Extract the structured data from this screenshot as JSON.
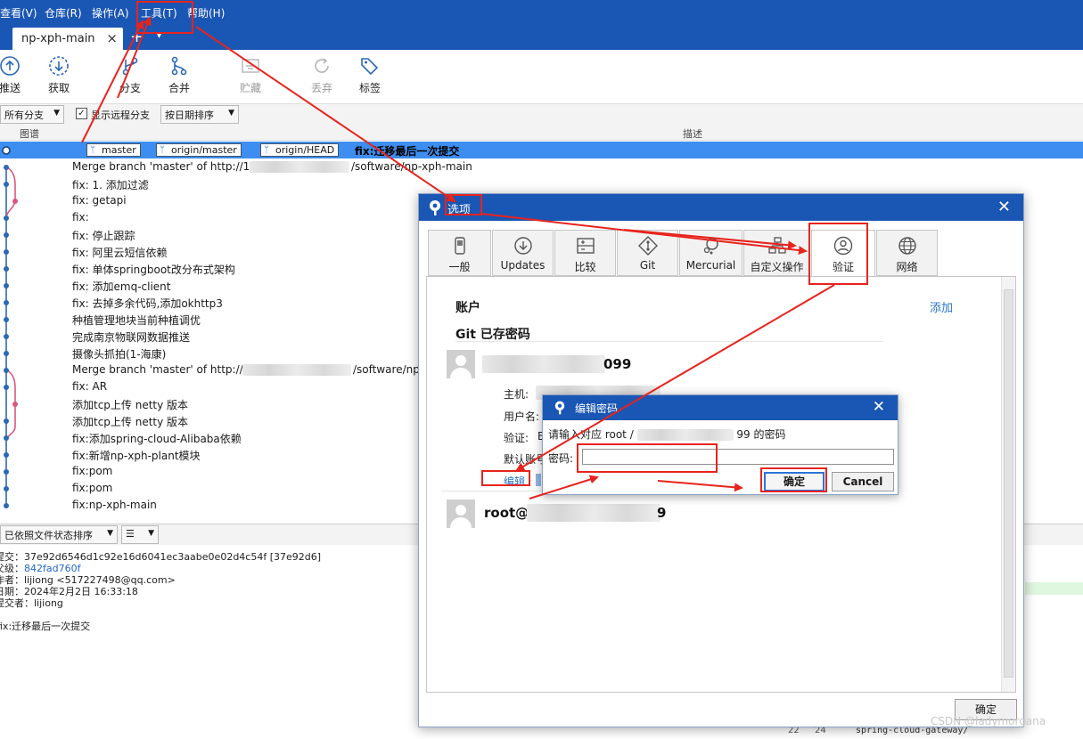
{
  "menu": {
    "items": [
      "查看(V)",
      "仓库(R)",
      "操作(A)",
      "工具(T)",
      "帮助(H)"
    ]
  },
  "tabbar": {
    "repo_tab_label": "np-xph-main",
    "close_glyph": "×",
    "add_glyph": "+",
    "dropdown_glyph": "▾"
  },
  "toolbar": {
    "buttons": [
      {
        "label": "推送",
        "icon": "push-icon",
        "enabled": true
      },
      {
        "label": "获取",
        "icon": "fetch-icon",
        "enabled": true
      },
      {
        "label": "分支",
        "icon": "branch-icon",
        "enabled": true
      },
      {
        "label": "合并",
        "icon": "merge-icon",
        "enabled": true
      },
      {
        "label": "贮藏",
        "icon": "stash-icon",
        "enabled": false
      },
      {
        "label": "丢弃",
        "icon": "discard-icon",
        "enabled": false
      },
      {
        "label": "标签",
        "icon": "tag-icon",
        "enabled": true
      }
    ]
  },
  "filter": {
    "branch_select": "所有分支",
    "show_remote_label": "显示远程分支",
    "show_remote_checked": true,
    "sort_select": "按日期排序"
  },
  "columns": {
    "graph": "图谱",
    "description": "描述"
  },
  "commits": {
    "selected": {
      "tags": [
        "master",
        "origin/master",
        "origin/HEAD"
      ],
      "message": "fix:迁移最后一次提交"
    },
    "rows": [
      "Merge branch 'master' of http://1",
      "/software/np-xph-main",
      "fix:  1. 添加过滤",
      "fix:  getapi",
      "fix:",
      "fix: 停止跟踪",
      "fix: 阿里云短信依赖",
      "fix: 单体springboot改分布式架构",
      "fix: 添加emq-client",
      "fix: 去掉多余代码,添加okhttp3",
      "种植管理地块当前种植调优",
      "完成南京物联网数据推送",
      "摄像头抓拍(1-海康)",
      "Merge branch 'master' of http://",
      "/software/np",
      "fix: AR",
      "添加tcp上传 netty 版本",
      "添加tcp上传 netty 版本",
      "fix:添加spring-cloud-Alibaba依赖",
      "fix:新增np-xph-plant模块",
      "fix:pom",
      "fix:pom",
      "fix:np-xph-main"
    ]
  },
  "bottom": {
    "sort_select": "已依照文件状态排序",
    "view_glyph": "☰",
    "details": {
      "commit_label": "提交：",
      "commit_value": "37e92d6546d1c92e16d6041ec3aabe0e02d4c54f [37e92d6]",
      "parent_label": "父级：",
      "parent_value": "842fad760f",
      "author_label": "作者：",
      "author_value": "lijiong <517227498@qq.com>",
      "date_label": "日期：",
      "date_value": "2024年2月2日 16:33:18",
      "committer_label": "提交者：",
      "committer_value": "lijiong",
      "message": "fix:迁移最后一次提交"
    },
    "line_numbers": [
      "22",
      "24"
    ],
    "code_line": "spring-cloud-gateway/",
    "watermark": "CSDN @ladymorgana"
  },
  "options_dialog": {
    "title": "选项",
    "close_glyph": "✕",
    "tabs": [
      {
        "label": "一般",
        "icon": "general-icon"
      },
      {
        "label": "Updates",
        "icon": "updates-icon"
      },
      {
        "label": "比较",
        "icon": "compare-icon"
      },
      {
        "label": "Git",
        "icon": "git-icon"
      },
      {
        "label": "Mercurial",
        "icon": "mercurial-icon"
      },
      {
        "label": "自定义操作",
        "icon": "custom-actions-icon"
      },
      {
        "label": "验证",
        "icon": "auth-user-icon"
      },
      {
        "label": "网络",
        "icon": "globe-icon"
      }
    ],
    "active_tab": "验证",
    "section_account": "账户",
    "add_link": "添加",
    "section_saved": "Git 已存密码",
    "account1_suffix": "099",
    "host_label": "主机:",
    "user_label": "用户名:",
    "auth_label": "验证:",
    "auth_value_partial": "B",
    "default_label_partial": "默认账号",
    "edit_link": "编辑",
    "account2_prefix": "root@",
    "account2_suffix": "9",
    "ok_button": "确定"
  },
  "password_dialog": {
    "title": "编辑密码",
    "close_glyph": "✕",
    "prompt_prefix": "请输入对应 root /",
    "prompt_suffix": "99 的密码",
    "password_label": "密码:",
    "password_value": "",
    "ok_button": "确定",
    "cancel_button": "Cancel"
  },
  "colors": {
    "title_bar": "#1a56b4",
    "selection": "#3d8ef0",
    "link": "#2a73c8",
    "annotation": "#e8231d",
    "graph_blue": "#2c69b5",
    "graph_pink": "#d8587c"
  }
}
